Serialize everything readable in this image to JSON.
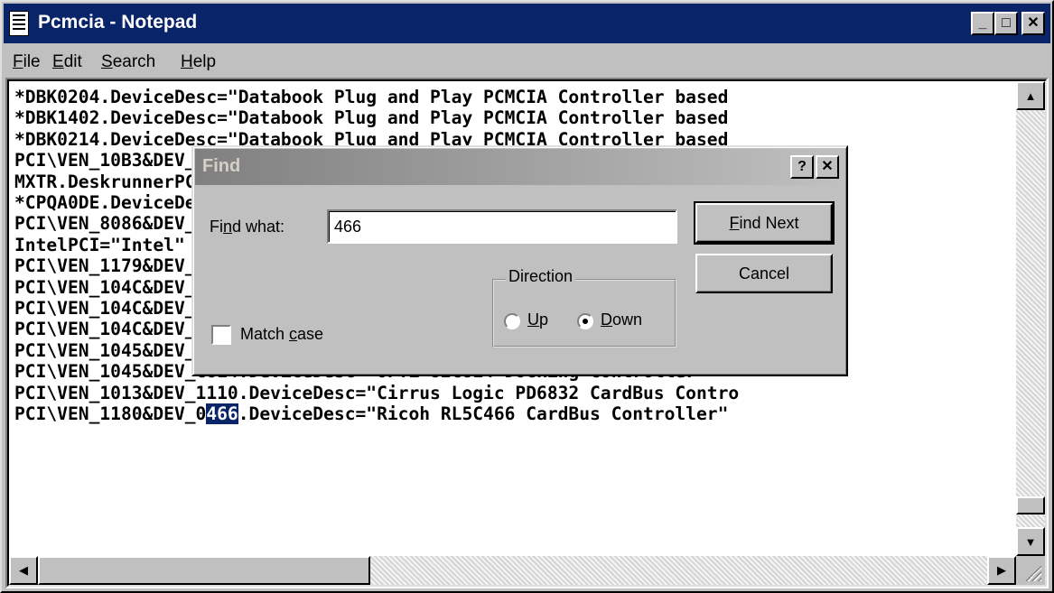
{
  "window": {
    "title": "Pcmcia - Notepad",
    "controls": {
      "minimize": "_",
      "maximize": "□",
      "close": "✕"
    },
    "icon": "notepad-icon"
  },
  "menubar": {
    "items": [
      {
        "prefix": "",
        "accel": "F",
        "rest": "ile"
      },
      {
        "prefix": "",
        "accel": "E",
        "rest": "dit"
      },
      {
        "prefix": "",
        "accel": "S",
        "rest": "earch"
      },
      {
        "prefix": "",
        "accel": "H",
        "rest": "elp"
      }
    ]
  },
  "editor": {
    "lines": [
      "*DBK0204.DeviceDesc=\"Databook Plug and Play PCMCIA Controller based",
      "*DBK1402.DeviceDesc=\"Databook Plug and Play PCMCIA Controller based",
      "*DBK0214.DeviceDesc=\"Databook Plug and Play PCMCIA Controller based",
      "PCI\\VEN_10B3&DEV_B106.DeviceDesc=\"SMC 34C90 CardBus Controller\"",
      "MXTR.DeskrunnerPCMCIA.DeviceDesc=\"Deskrunner Controller\"",
      "*CPQA0DE.DeviceDesc=\"Compaq PCMCIA Controller\"",
      "PCI\\VEN_8086&DEV_1221.DeviceDesc=\"Intel 82092AA PCMCIA Bridge",
      "IntelPCI=\"Intel\"",
      "PCI\\VEN_1179&DEV_0617.DeviceDesc=\"Toshiba CardBus Controller",
      "PCI\\VEN_104C&DEV_AC12.DeviceDesc=\"Texas Instruments PCI-1130 CardBus",
      "PCI\\VEN_104C&DEV_AC15.DeviceDesc=\"Texas Instruments PCI-1131 CardBus",
      "PCI\\VEN_104C&DEV_AC13.DeviceDesc=\"Texas Instruments PCI-1031 PCMCIA",
      "PCI\\VEN_1045&DEV_C824.DeviceDesc=\"OPTi 82C824 CardBus Controller\"",
      "PCI\\VEN_1045&DEV_C814.DeviceDesc=\"OPTi 82C814 Docking Controller\"",
      "PCI\\VEN_1013&DEV_1110.DeviceDesc=\"Cirrus Logic PD6832 CardBus Contro"
    ],
    "last_line": {
      "before": "PCI\\VEN_1180&DEV_0",
      "selected": "466",
      "after": ".DeviceDesc=\"Ricoh RL5C466 CardBus Controller\""
    }
  },
  "scrollbars": {
    "up": "▲",
    "down": "▼",
    "left": "◀",
    "right": "▶"
  },
  "find_dialog": {
    "title": "Find",
    "help_button": "?",
    "close_button": "✕",
    "find_what_label": {
      "prefix": "Fi",
      "accel": "n",
      "rest": "d what:"
    },
    "find_what_value": "466",
    "find_next": {
      "prefix": "",
      "accel": "F",
      "rest": "ind Next"
    },
    "cancel": "Cancel",
    "direction_label": "Direction",
    "up": {
      "prefix": "",
      "accel": "U",
      "rest": "p"
    },
    "down": {
      "prefix": "",
      "accel": "D",
      "rest": "own"
    },
    "match_case": {
      "prefix": "Match ",
      "accel": "c",
      "rest": "ase"
    },
    "direction_selected": "down",
    "match_case_checked": false
  }
}
